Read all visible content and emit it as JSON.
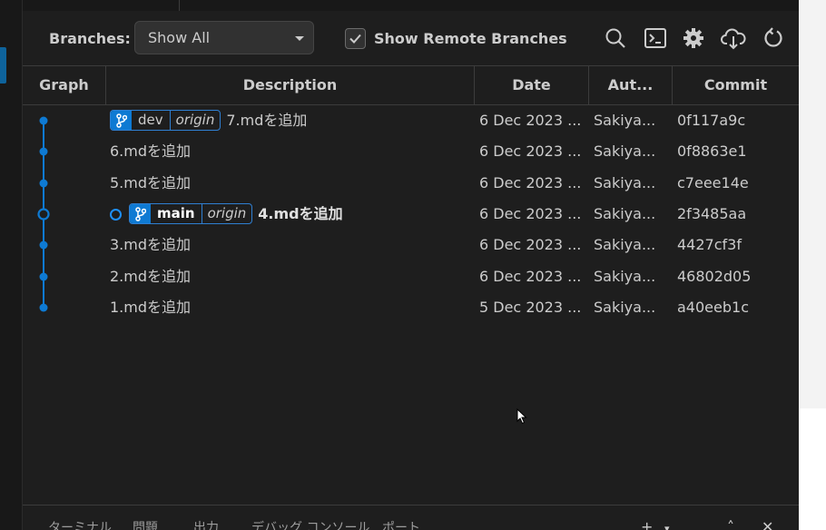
{
  "toolbar": {
    "branches_label": "Branches:",
    "branch_select_value": "Show All",
    "show_remote_label": "Show Remote Branches",
    "show_remote_checked": true
  },
  "columns": {
    "graph": "Graph",
    "description": "Description",
    "date": "Date",
    "author": "Aut...",
    "commit": "Commit"
  },
  "commits": [
    {
      "refs": [
        {
          "name": "dev",
          "remote": "origin",
          "head": false
        }
      ],
      "message": "7.mdを追加",
      "date": "6 Dec 2023 ...",
      "author": "Sakiya...",
      "hash": "0f117a9c"
    },
    {
      "refs": [],
      "message": "6.mdを追加",
      "date": "6 Dec 2023 ...",
      "author": "Sakiya...",
      "hash": "0f8863e1"
    },
    {
      "refs": [],
      "message": "5.mdを追加",
      "date": "6 Dec 2023 ...",
      "author": "Sakiya...",
      "hash": "c7eee14e"
    },
    {
      "refs": [
        {
          "name": "main",
          "remote": "origin",
          "head": true
        }
      ],
      "message": "4.mdを追加",
      "date": "6 Dec 2023 ...",
      "author": "Sakiya...",
      "hash": "2f3485aa"
    },
    {
      "refs": [],
      "message": "3.mdを追加",
      "date": "6 Dec 2023 ...",
      "author": "Sakiya...",
      "hash": "4427cf3f"
    },
    {
      "refs": [],
      "message": "2.mdを追加",
      "date": "6 Dec 2023 ...",
      "author": "Sakiya...",
      "hash": "46802d05"
    },
    {
      "refs": [],
      "message": "1.mdを追加",
      "date": "5 Dec 2023 ...",
      "author": "Sakiya...",
      "hash": "a40eeb1c"
    }
  ],
  "bottom_tabs": [
    "ターミナル",
    "問題",
    "出力",
    "デバッグ コンソール",
    "ポート"
  ],
  "icons": {
    "toolbar": [
      "search-icon",
      "terminal-icon",
      "gear-icon",
      "cloud-download-icon",
      "refresh-icon"
    ],
    "bottom": [
      "plus-icon",
      "chevron-down-icon",
      "more-icon",
      "chevron-up-icon",
      "close-icon"
    ]
  },
  "colors": {
    "accent": "#0e7ad3",
    "graph": "#0e7ad3",
    "background": "#1e1e1e",
    "text": "#cccccc"
  }
}
